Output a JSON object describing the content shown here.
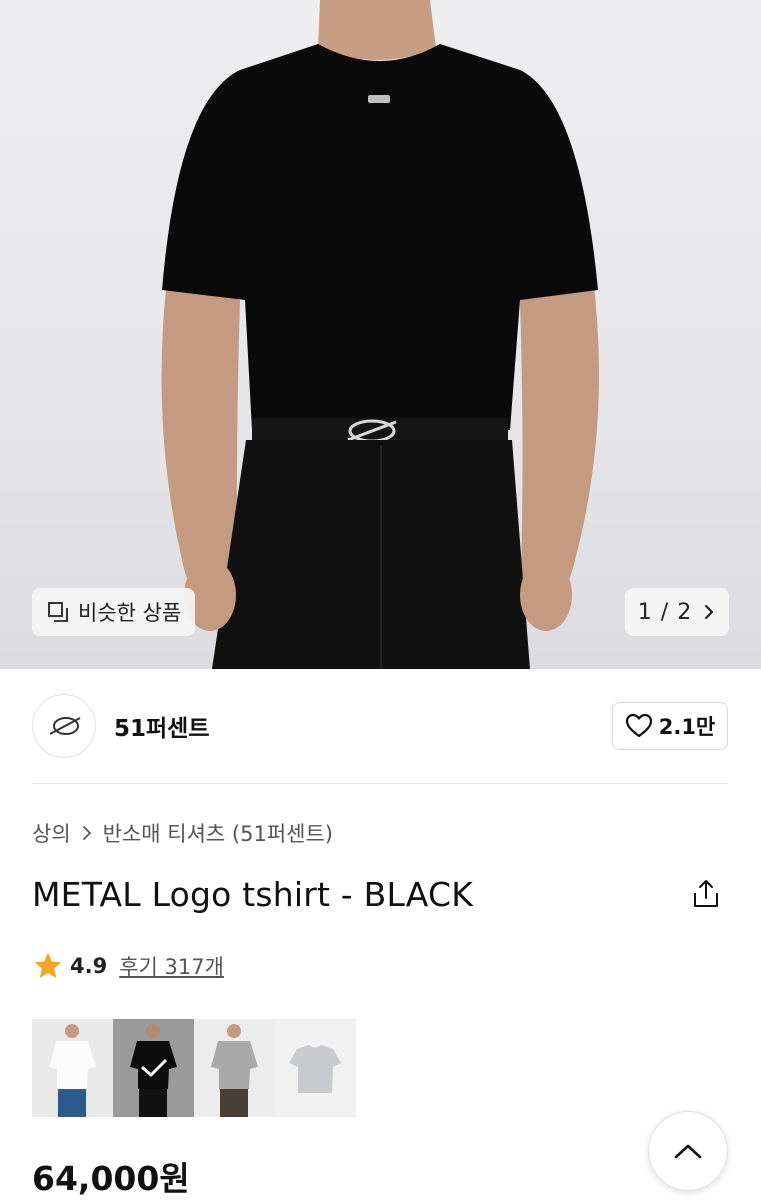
{
  "hero": {
    "similar_label": "비슷한 상품",
    "page_indicator": "1 / 2"
  },
  "brand": {
    "name": "51퍼센트",
    "likes": "2.1만"
  },
  "breadcrumb": {
    "items": [
      "상의",
      "반소매 티셔츠 (51퍼센트)"
    ]
  },
  "product": {
    "title": "METAL Logo tshirt - BLACK",
    "rating": "4.9",
    "reviews": "후기 317개",
    "price": "64,000원",
    "variants": [
      {
        "color": "white",
        "selected": false
      },
      {
        "color": "black",
        "selected": true
      },
      {
        "color": "gray",
        "selected": false
      },
      {
        "color": "light-gray-flat",
        "selected": false
      }
    ]
  },
  "icons": {
    "similar": "similar-items-icon",
    "chevron": "chevron-right-icon",
    "heart": "heart-icon",
    "share": "share-icon",
    "star": "star-icon",
    "check": "check-icon",
    "up": "chevron-up-icon"
  },
  "colors": {
    "star": "#f5a623",
    "text": "#111111",
    "muted": "#555555"
  }
}
